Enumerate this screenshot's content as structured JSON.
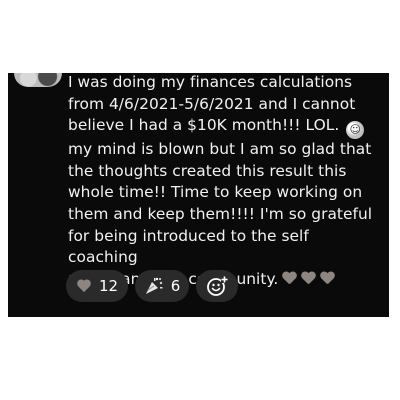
{
  "post": {
    "text_main": "I was doing my finances calculations\nfrom 4/6/2021-5/6/2021 and I cannot\nbelieve I had a $10K month!!! LOL.",
    "text_rest": "my mind is blown but I am so glad that\nthe thoughts created this result this\nwhole time!! Time to keep working on\nthem and keep them!!!! I'm so grateful\nfor being introduced to the self coaching\nmodel and this community.",
    "inline_emoji_icon": "rolling-on-floor-laughing-icon",
    "end_emoji_icons": [
      "heart-icon",
      "heart-icon",
      "heart-icon"
    ]
  },
  "reactions": [
    {
      "icon": "heart-icon",
      "count": "12"
    },
    {
      "icon": "party-popper-icon",
      "count": "6"
    }
  ],
  "add_reaction_icon": "add-reaction-icon",
  "colors": {
    "card_background": "#0a0a0a",
    "text": "#f2f2f2",
    "pill_background": "#2a2a2a",
    "heart": "#8e8580"
  }
}
